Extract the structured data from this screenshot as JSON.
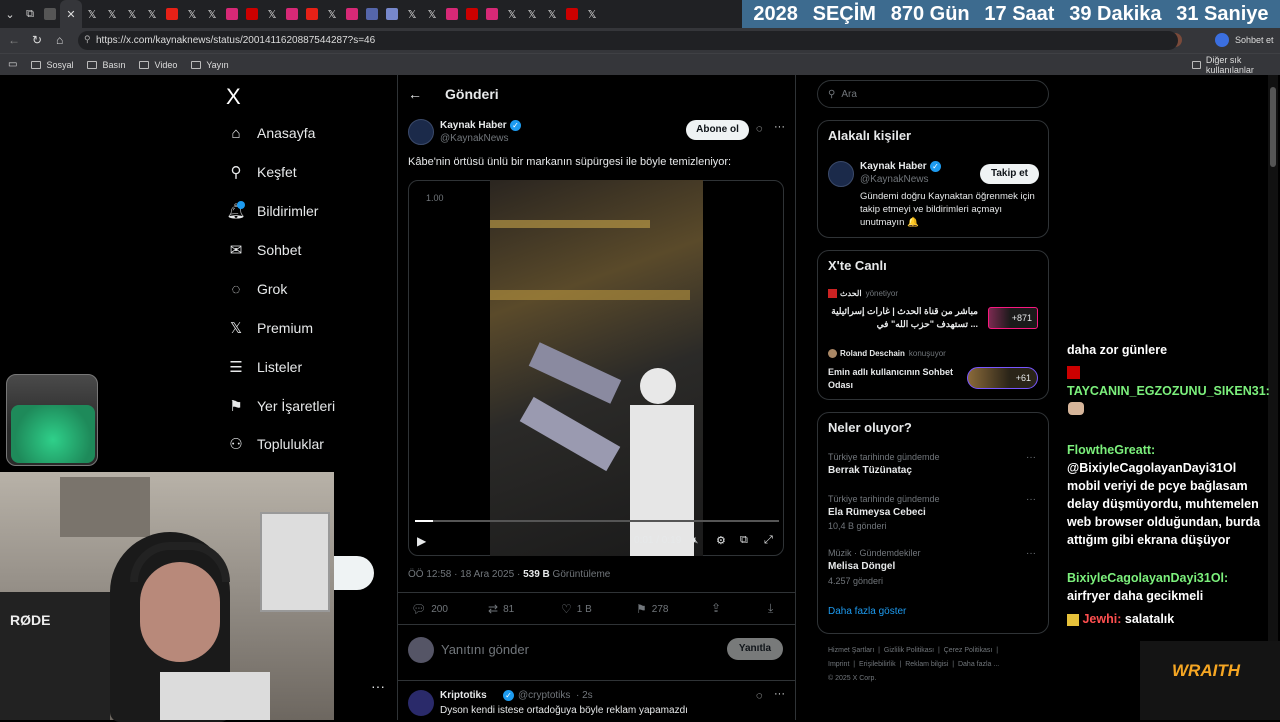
{
  "browser": {
    "url": "https://x.com/kaynaknews/status/2001411620887544287?s=46",
    "profile_label": "Sohbet et",
    "bookmarks": [
      "Sosyal",
      "Basın",
      "Video",
      "Yayın"
    ],
    "other_bookmarks": "Diğer sık kullanılanlar"
  },
  "countdown": {
    "year": "2028",
    "label": "SEÇİM",
    "days": "870 Gün",
    "hours": "17 Saat",
    "minutes": "39 Dakika",
    "seconds": "31 Saniye"
  },
  "nav": {
    "logo": "X",
    "items": [
      {
        "label": "Anasayfa",
        "icon": "home-icon"
      },
      {
        "label": "Keşfet",
        "icon": "search-icon"
      },
      {
        "label": "Bildirimler",
        "icon": "bell-icon"
      },
      {
        "label": "Sohbet",
        "icon": "mail-icon"
      },
      {
        "label": "Grok",
        "icon": "grok-icon"
      },
      {
        "label": "Premium",
        "icon": "x-icon"
      },
      {
        "label": "Listeler",
        "icon": "list-icon"
      },
      {
        "label": "Yer İşaretleri",
        "icon": "bookmark-icon"
      },
      {
        "label": "Topluluklar",
        "icon": "people-icon"
      }
    ]
  },
  "post": {
    "header": "Gönderi",
    "author": "Kaynak Haber",
    "handle": "@KaynakNews",
    "subscribe_label": "Abone ol",
    "text": "Kâbe'nin örtüsü ünlü bir markanın süpürgesi ile böyle temizleniyor:",
    "video_speed": "1.00",
    "video_time": "0:01 / 0:19",
    "progress_fraction": 0.05,
    "timestamp": "ÖÖ 12:58 · 18 Ara 2025 · ",
    "views": "539 B",
    "views_label": "Görüntüleme",
    "replies": "200",
    "reposts": "81",
    "likes": "1 B",
    "bookmarks": "278",
    "reply_placeholder": "Yanıtını gönder",
    "reply_button": "Yanıtla"
  },
  "reply_preview": {
    "author": "Kriptotiks",
    "handle": "@cryptotiks",
    "time": "· 2s",
    "text": "Dyson kendi istese ortadoğuya böyle reklam yapamazdı"
  },
  "search": {
    "placeholder": "Ara"
  },
  "related": {
    "title": "Alakalı kişiler",
    "name": "Kaynak Haber",
    "handle": "@KaynakNews",
    "follow_label": "Takip et",
    "bio": "Gündemi doğru Kaynaktan öğrenmek için takip etmeyi ve bildirimleri açmayı unutmayın 🔔"
  },
  "live": {
    "title": "X'te Canlı",
    "items": [
      {
        "host": "الحدث",
        "role": "yönetiyor",
        "title": "مباشر من قناة الحدث | غارات إسرائيلية تستهدف \"حزب الله\" في ...",
        "count": "+871"
      },
      {
        "host": "Roland Deschain",
        "role": "konuşuyor",
        "title": "Emin adlı kullanıcının Sohbet Odası",
        "count": "+61"
      }
    ]
  },
  "trends": {
    "title": "Neler oluyor?",
    "items": [
      {
        "context": "Türkiye tarihinde gündemde",
        "name": "Berrak Tüzünataç",
        "count": ""
      },
      {
        "context": "Türkiye tarihinde gündemde",
        "name": "Ela Rümeysa Cebeci",
        "count": "10,4 B gönderi"
      },
      {
        "context": "Müzik · Gündemdekiler",
        "name": "Melisa Döngel",
        "count": "4.257 gönderi"
      }
    ],
    "more": "Daha fazla göster"
  },
  "footer": {
    "links": [
      "Hizmet Şartları",
      "Gizlilik Politikası",
      "Çerez Politikası",
      "Imprint",
      "Erişilebilirlik",
      "Reklam bilgisi",
      "Daha fazla ..."
    ],
    "copyright": "© 2025 X Corp."
  },
  "chat_overlay": [
    {
      "user": "",
      "message": "daha zor günlere"
    },
    {
      "user": "TAYCANIN_EGZOZUNU_SIKEN31:",
      "message": ""
    },
    {
      "user": "FlowtheGreatt:",
      "message": "@BixiyleCagolayanDayi31Ol mobil veriyi de pcye bağlasam delay düşmüyordu, muhtemelen web browser olduğundan, burda attığım gibi ekrana düşüyor"
    },
    {
      "user": "BixiyleCagolayanDayi31Ol:",
      "message": "airfryer daha gecikmeli"
    },
    {
      "user": "Jewhi:",
      "message": "salatalık"
    }
  ],
  "overlay_brand": "WRAITH",
  "webcam_label": "RØDE",
  "colors": {
    "accent": "#1d9bf0",
    "background": "#000000",
    "countdown_bg": "#3d6b8f",
    "chat_green": "#7cf07c"
  }
}
